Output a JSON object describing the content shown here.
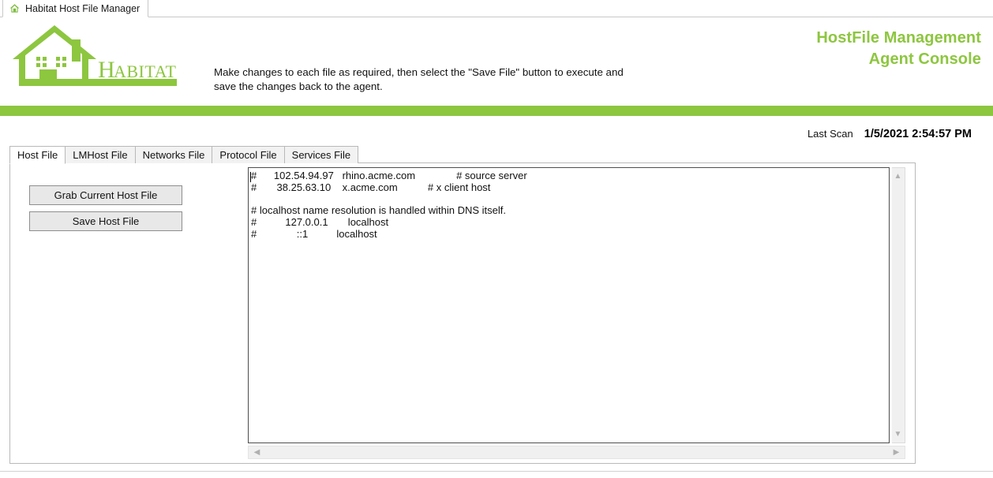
{
  "browser_tab": {
    "title": "Habitat Host File Manager",
    "icon": "house-icon"
  },
  "header": {
    "logo_text": "HABITAT",
    "logo_icon": "habitat-house-logo",
    "instructions": "Make changes to each file as required, then select the \"Save File\" button to execute and save the changes back to the agent.",
    "console_title_line1": "HostFile Management",
    "console_title_line2": "Agent Console",
    "accent_color": "#8DC63F"
  },
  "status": {
    "last_scan_label": "Last Scan",
    "last_scan_value": "1/5/2021 2:54:57 PM"
  },
  "tabs": [
    {
      "label": "Host File",
      "active": true
    },
    {
      "label": "LMHost File",
      "active": false
    },
    {
      "label": "Networks File",
      "active": false
    },
    {
      "label": "Protocol File",
      "active": false
    },
    {
      "label": "Services File",
      "active": false
    }
  ],
  "actions": {
    "grab_label": "Grab Current Host File",
    "save_label": "Save Host File"
  },
  "editor": {
    "content": "#\t102.54.94.97\trhino.acme.com\t\t# source server\n#\t 38.25.63.10\tx.acme.com\t      # x client host\n\n# localhost name resolution is handled within DNS itself.\n#\t    127.0.0.1\t  localhost\n#\t        ::1\t      localhost",
    "scrollbars": {
      "vertical_up": "▲",
      "vertical_down": "▼",
      "horizontal_left": "◀",
      "horizontal_right": "▶"
    }
  }
}
